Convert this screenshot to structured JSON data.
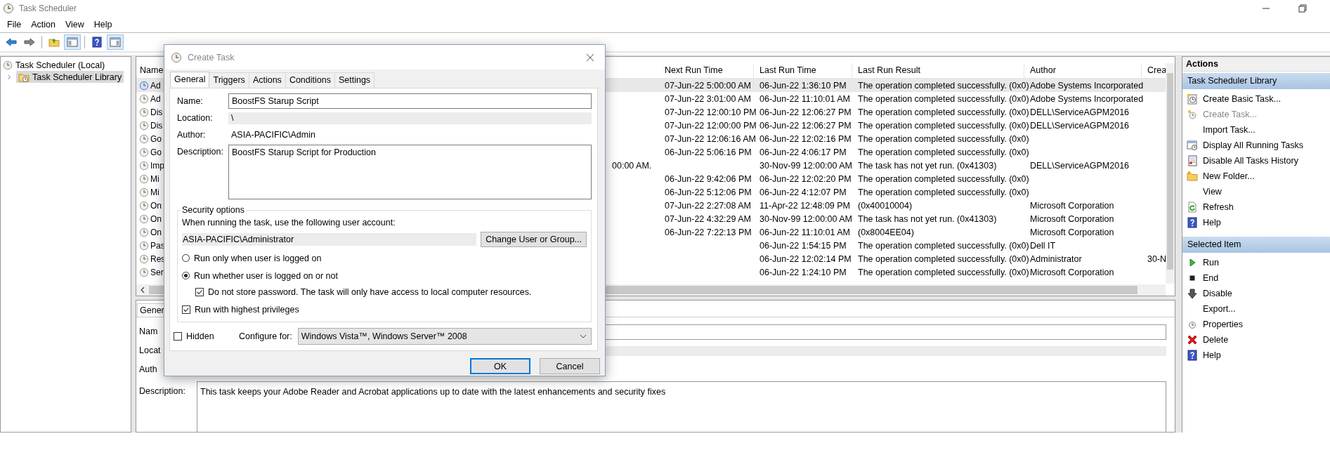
{
  "window": {
    "title": "Task Scheduler"
  },
  "menu": [
    "File",
    "Action",
    "View",
    "Help"
  ],
  "toolbar": [
    {
      "kind": "back",
      "on": false
    },
    {
      "kind": "forward",
      "on": false
    },
    {
      "kind": "folder",
      "on": false
    },
    {
      "kind": "console-tree",
      "on": true
    },
    {
      "kind": "help",
      "on": false
    },
    {
      "kind": "action-pane",
      "on": true
    }
  ],
  "tree": [
    {
      "label": "Task Scheduler (Local)",
      "selected": false,
      "children": [
        {
          "label": "Task Scheduler Library",
          "selected": true,
          "expanded": false
        }
      ]
    }
  ],
  "table": {
    "columns": {
      "name": "Name",
      "next_run_time": "Next Run Time",
      "last_run_time": "Last Run Time",
      "last_run_result": "Last Run Result",
      "author": "Author",
      "created": "Crea"
    },
    "rows": [
      {
        "selected": true,
        "name": "Ad",
        "next_run_time": "07-Jun-22 5:00:00 AM",
        "last_run_time": "06-Jun-22 1:36:10 PM",
        "last_run_result": "The operation completed successfully. (0x0)",
        "author": "Adobe Systems Incorporated"
      },
      {
        "selected": false,
        "name": "Ad",
        "next_run_time": "07-Jun-22 3:01:00 AM",
        "last_run_time": "06-Jun-22 11:10:01 AM",
        "last_run_result": "The operation completed successfully. (0x0)",
        "author": "Adobe Systems Incorporated"
      },
      {
        "selected": false,
        "name": "Dis",
        "next_run_time": "07-Jun-22 12:00:10 PM",
        "last_run_time": "06-Jun-22 12:06:27 PM",
        "last_run_result": "The operation completed successfully. (0x0)",
        "author": "DELL\\ServiceAGPM2016"
      },
      {
        "selected": false,
        "name": "Dis",
        "next_run_time": "07-Jun-22 12:00:00 PM",
        "last_run_time": "06-Jun-22 12:06:27 PM",
        "last_run_result": "The operation completed successfully. (0x0)",
        "author": "DELL\\ServiceAGPM2016"
      },
      {
        "selected": false,
        "name": "Go",
        "next_run_time": "07-Jun-22 12:06:16 AM",
        "last_run_time": "06-Jun-22 12:02:16 PM",
        "last_run_result": "The operation completed successfully. (0x0)"
      },
      {
        "selected": false,
        "name": "Go",
        "next_run_time": "06-Jun-22 5:06:16 PM",
        "last_run_time": "06-Jun-22 4:06:17 PM",
        "last_run_result": "The operation completed successfully. (0x0)"
      },
      {
        "selected": false,
        "name": "Imp",
        "column_2": "00:00 AM.",
        "last_run_time": "30-Nov-99 12:00:00 AM",
        "last_run_result": "The task has not yet run. (0x41303)",
        "author": "DELL\\ServiceAGPM2016"
      },
      {
        "selected": false,
        "name": "Mi",
        "next_run_time": "06-Jun-22 9:42:06 PM",
        "last_run_time": "06-Jun-22 12:02:20 PM",
        "last_run_result": "The operation completed successfully. (0x0)"
      },
      {
        "selected": false,
        "name": "Mi",
        "next_run_time": "06-Jun-22 5:12:06 PM",
        "last_run_time": "06-Jun-22 4:12:07 PM",
        "last_run_result": "The operation completed successfully. (0x0)"
      },
      {
        "selected": false,
        "name": "On",
        "next_run_time": "07-Jun-22 2:27:08 AM",
        "last_run_time": "11-Apr-22 12:48:09 PM",
        "last_run_result": "(0x40010004)",
        "author": "Microsoft Corporation"
      },
      {
        "selected": false,
        "name": "On",
        "next_run_time": "07-Jun-22 4:32:29 AM",
        "last_run_time": "30-Nov-99 12:00:00 AM",
        "last_run_result": "The task has not yet run. (0x41303)",
        "author": "Microsoft Corporation"
      },
      {
        "selected": false,
        "name": "On",
        "next_run_time": "06-Jun-22 7:22:13 PM",
        "last_run_time": "06-Jun-22 11:10:01 AM",
        "last_run_result": "(0x8004EE04)",
        "author": "Microsoft Corporation"
      },
      {
        "selected": false,
        "name": "Pas",
        "last_run_time": "06-Jun-22 1:54:15 PM",
        "last_run_result": "The operation completed successfully. (0x0)",
        "author": "Dell IT"
      },
      {
        "selected": false,
        "name": "Res",
        "last_run_time": "06-Jun-22 12:02:14 PM",
        "last_run_result": "The operation completed successfully. (0x0)",
        "author": "Administrator",
        "created": "30-N"
      },
      {
        "selected": false,
        "name": "Ser",
        "last_run_time": "06-Jun-22 1:24:10 PM",
        "last_run_result": "The operation completed successfully. (0x0)",
        "author": "Microsoft Corporation"
      }
    ]
  },
  "details": {
    "tabs": [
      {
        "label": "Gener",
        "selected": true
      }
    ],
    "fields": [
      {
        "label": "Nam",
        "kind": "textbox"
      },
      {
        "label": "Locat",
        "kind": "readonly"
      },
      {
        "label": "Auth",
        "kind": "text"
      },
      {
        "label": "Description:",
        "kind": "textarea",
        "value": "This task keeps your Adobe Reader and Acrobat applications up to date with the latest enhancements and security fixes"
      }
    ]
  },
  "dialog": {
    "title": "Create Task",
    "tabs": [
      {
        "label": "General",
        "selected": true
      },
      {
        "label": "Triggers",
        "selected": false
      },
      {
        "label": "Actions",
        "selected": false
      },
      {
        "label": "Conditions",
        "selected": false
      },
      {
        "label": "Settings",
        "selected": false
      }
    ],
    "name": {
      "label": "Name:",
      "value": "BoostFS Starup Script"
    },
    "location": {
      "label": "Location:",
      "value": "\\"
    },
    "author": {
      "label": "Author:",
      "value": "ASIA-PACIFIC\\Admin"
    },
    "description": {
      "label": "Description:",
      "value": "BoostFS Starup Script for Production"
    },
    "security": {
      "title": "Security options",
      "account_label": "When running the task, use the following user account:",
      "account": "ASIA-PACIFIC\\Administrator",
      "change_button": "Change User or Group...",
      "options": [
        {
          "kind": "radio",
          "label": "Run only when user is logged on",
          "selected": false
        },
        {
          "kind": "radio",
          "label": "Run whether user is logged on or not",
          "selected": true,
          "children": [
            {
              "kind": "checkbox",
              "label": "Do not store password.  The task will only have access to local computer resources.",
              "checked": true
            }
          ]
        },
        {
          "kind": "checkbox",
          "label": "Run with highest privileges",
          "checked": true
        }
      ]
    },
    "hidden": {
      "label": "Hidden",
      "checked": false
    },
    "configure_for": {
      "label": "Configure for:",
      "value": "Windows Vista™, Windows Server™ 2008"
    },
    "buttons": [
      {
        "label": "OK",
        "default": true
      },
      {
        "label": "Cancel",
        "default": false
      }
    ]
  },
  "actions": {
    "title": "Actions",
    "sections": [
      {
        "title": "Task Scheduler Library",
        "items": [
          {
            "label": "Create Basic Task...",
            "kind": "create-basic",
            "disabled": false
          },
          {
            "label": "Create Task...",
            "kind": "create-task",
            "disabled": true
          },
          {
            "label": "Import Task...",
            "disabled": false
          },
          {
            "label": "Display All Running Tasks",
            "kind": "running",
            "disabled": false
          },
          {
            "label": "Disable All Tasks History",
            "kind": "history",
            "disabled": false
          },
          {
            "label": "New Folder...",
            "kind": "folder",
            "disabled": false
          },
          {
            "label": "View",
            "disabled": false
          },
          {
            "label": "Refresh",
            "kind": "refresh",
            "disabled": false
          },
          {
            "label": "Help",
            "kind": "help",
            "disabled": false
          }
        ]
      },
      {
        "title": "Selected Item",
        "items": [
          {
            "label": "Run",
            "kind": "run",
            "disabled": false
          },
          {
            "label": "End",
            "kind": "end",
            "disabled": false
          },
          {
            "label": "Disable",
            "kind": "disable",
            "disabled": false
          },
          {
            "label": "Export...",
            "disabled": false
          },
          {
            "label": "Properties",
            "kind": "properties",
            "disabled": false
          },
          {
            "label": "Delete",
            "kind": "delete",
            "disabled": false
          },
          {
            "label": "Help",
            "kind": "help",
            "disabled": false
          }
        ]
      }
    ]
  }
}
